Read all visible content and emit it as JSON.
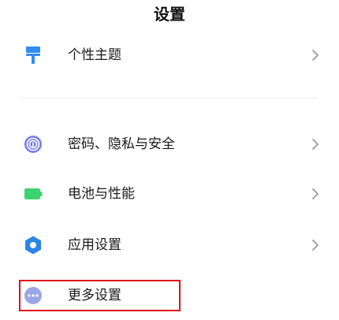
{
  "header": {
    "title": "设置"
  },
  "items": [
    {
      "label": "个性主题",
      "icon": "paintbrush-icon",
      "icon_color": "#2f8cf0",
      "has_chevron": true
    },
    {
      "label": "密码、隐私与安全",
      "icon": "fingerprint-icon",
      "icon_color": "#7a7ff0",
      "has_chevron": true
    },
    {
      "label": "电池与性能",
      "icon": "battery-icon",
      "icon_color": "#3ed16f",
      "has_chevron": true
    },
    {
      "label": "应用设置",
      "icon": "gear-icon",
      "icon_color": "#2a86e8",
      "has_chevron": true
    },
    {
      "label": "更多设置",
      "icon": "more-dots-icon",
      "icon_color": "#9aa7e6",
      "has_chevron": false
    }
  ],
  "colors": {
    "chevron": "#9a9a9a",
    "highlight_border": "#e0101a"
  }
}
